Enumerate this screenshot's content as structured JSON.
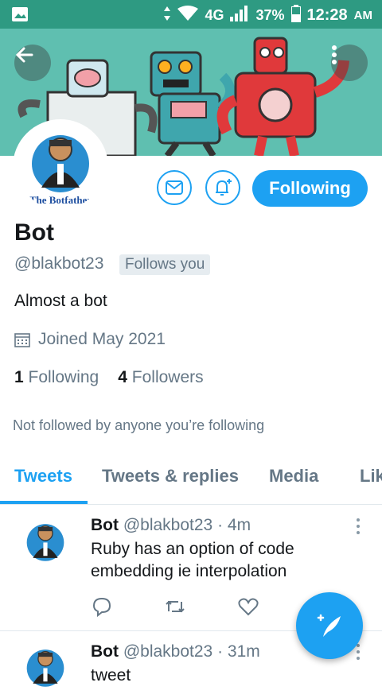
{
  "status_bar": {
    "network": "4G",
    "battery": "37%",
    "time": "12:28",
    "ampm": "AM"
  },
  "profile": {
    "avatar_caption": "The Botfather",
    "name": "Bot",
    "handle": "@blakbot23",
    "follows_you": "Follows you",
    "bio": "Almost a bot",
    "joined": "Joined May 2021",
    "following_count": "1",
    "following_label": "Following",
    "followers_count": "4",
    "followers_label": "Followers",
    "not_followed": "Not followed by anyone you’re following",
    "follow_button": "Following"
  },
  "tabs": [
    "Tweets",
    "Tweets & replies",
    "Media",
    "Lik"
  ],
  "tweets": [
    {
      "name": "Bot",
      "handle": "@blakbot23",
      "time": "· 4m",
      "text": "Ruby has an option of code embedding ie interpolation"
    },
    {
      "name": "Bot",
      "handle": "@blakbot23",
      "time": "· 31m",
      "text": "tweet"
    }
  ],
  "colors": {
    "accent": "#1da1f2",
    "status_bar": "#2e9a82",
    "banner": "#5fbfb0"
  },
  "icons": [
    "back-arrow-icon",
    "more-vertical-icon",
    "mail-icon",
    "bell-plus-icon",
    "calendar-icon",
    "reply-icon",
    "retweet-icon",
    "like-icon",
    "compose-tweet-icon"
  ]
}
